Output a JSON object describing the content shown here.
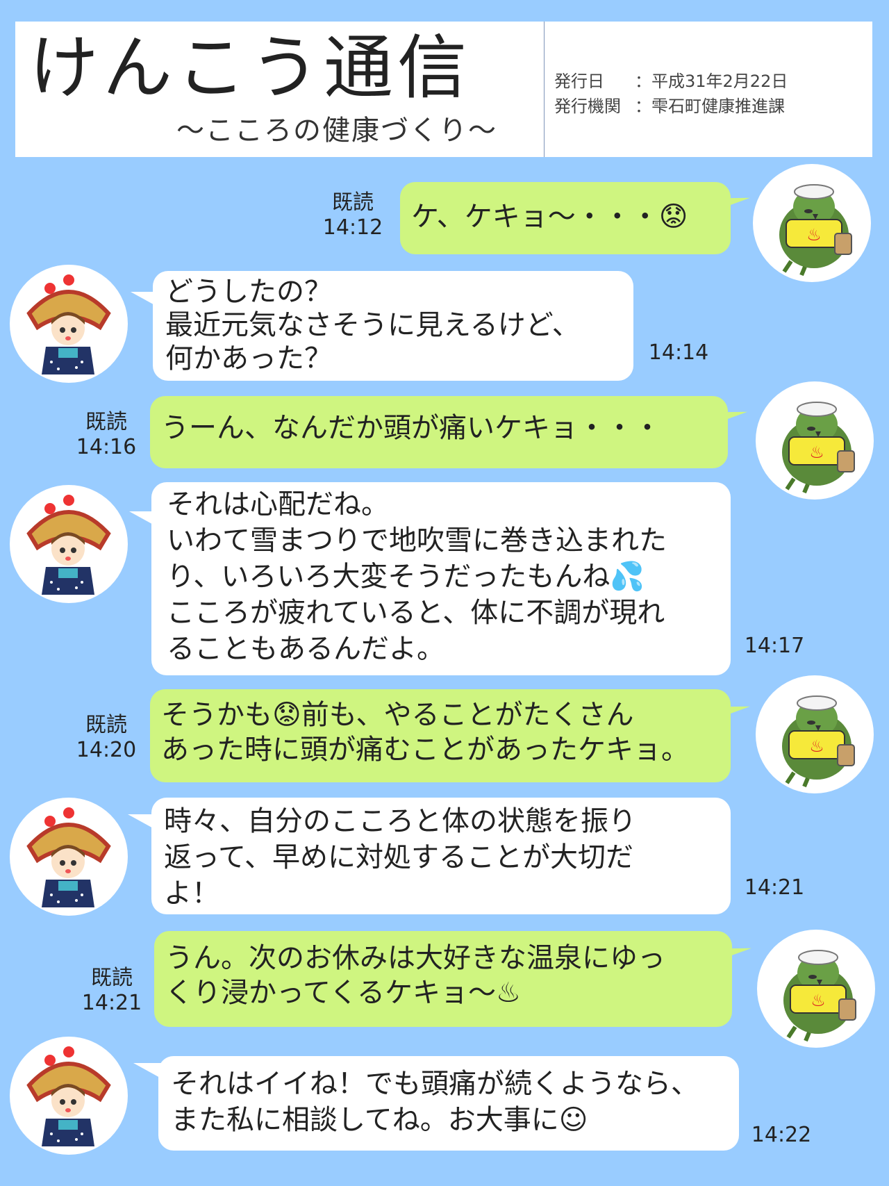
{
  "header": {
    "title": "けんこう通信",
    "subtitle": "～こころの健康づくり～",
    "issue_date_label": "発行日",
    "issue_date_value": "：平成31年2月22日",
    "publisher_label": "発行機関",
    "publisher_value": "：雫石町健康推進課"
  },
  "messages": [
    {
      "id": "m1",
      "side": "right",
      "lines": [
        "ケ、ケキョ～・・・😟"
      ],
      "read": "既読",
      "time": "14:12"
    },
    {
      "id": "m2",
      "side": "left",
      "lines": [
        "どうしたの？",
        "最近元気なさそうに見えるけど、",
        "何かあった？"
      ],
      "time": "14:14"
    },
    {
      "id": "m3",
      "side": "right",
      "lines": [
        "うーん、なんだか頭が痛いケキョ・・・"
      ],
      "read": "既読",
      "time": "14:16"
    },
    {
      "id": "m4",
      "side": "left",
      "lines": [
        "それは心配だね。",
        "いわて雪まつりで地吹雪に巻き込まれた",
        "り、いろいろ大変そうだったもんね💦",
        "こころが疲れていると、体に不調が現れ",
        "ることもあるんだよ。"
      ],
      "time": "14:17"
    },
    {
      "id": "m5",
      "side": "right",
      "lines": [
        "そうかも😟前も、やることがたくさん",
        "あった時に頭が痛むことがあったケキョ。"
      ],
      "read": "既読",
      "time": "14:20"
    },
    {
      "id": "m6",
      "side": "left",
      "lines": [
        "時々、自分のこころと体の状態を振り",
        "返って、早めに対処することが大切だ",
        "よ！"
      ],
      "time": "14:21"
    },
    {
      "id": "m7",
      "side": "right",
      "lines": [
        "うん。次のお休みは大好きな温泉にゆっ",
        "くり浸かってくるケキョ～♨"
      ],
      "read": "既読",
      "time": "14:21"
    },
    {
      "id": "m8",
      "side": "left",
      "lines": [
        "それはイイね！でも頭痛が続くようなら、",
        "また私に相談してね。お大事に☺"
      ],
      "time": "14:22"
    }
  ],
  "colors": {
    "background": "#99ccff",
    "bubble_green": "#cff580",
    "bubble_white": "#ffffff"
  },
  "icons": {
    "right_avatar": "bird-mascot-icon",
    "left_avatar": "girl-mascot-icon"
  }
}
